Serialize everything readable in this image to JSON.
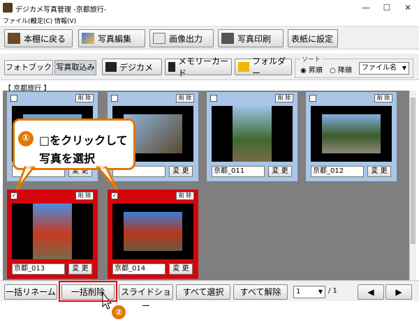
{
  "window": {
    "title": "デジカメ写真管理 -京都旅行-",
    "minimize": "—",
    "maximize": "☐",
    "close": "✕"
  },
  "menu": [
    "ファイル(F)",
    "設定(C)",
    "情報(V)"
  ],
  "toolbar": {
    "back": "本棚に戻る",
    "edit": "写真編集",
    "export": "画像出力",
    "print": "写真印刷",
    "cover": "表紙に設定"
  },
  "modes": {
    "photobook": "フォトブック",
    "import": "写真取込み"
  },
  "sources": {
    "camera": "デジカメ",
    "memory": "メモリーカード",
    "folder": "フォルダー"
  },
  "sort": {
    "legend": "ソート",
    "asc": "昇順",
    "desc": "降順",
    "field": "ファイル名"
  },
  "breadcrumb": "【 京都旅行 】",
  "photos": [
    {
      "name": "",
      "selected": false
    },
    {
      "name": "",
      "selected": false
    },
    {
      "name": "京都_011",
      "selected": false
    },
    {
      "name": "京都_012",
      "selected": false
    },
    {
      "name": "京都_013",
      "selected": true
    },
    {
      "name": "京都_014",
      "selected": true
    }
  ],
  "card_labels": {
    "delete": "削 除",
    "change": "変 更",
    "check": "✓"
  },
  "bottom": {
    "rename": "一括リネーム",
    "delete_all": "一括削除",
    "slideshow": "スライドショー",
    "select_all": "すべて選択",
    "deselect_all": "すべて解除",
    "page": "1",
    "page_total": "/ 1",
    "prev": "◀",
    "next": "▶"
  },
  "callout": {
    "number": "①",
    "line1": "□をクリックして",
    "line2": "写真を選択",
    "step2": "②"
  },
  "colors": {
    "selected_card": "#d4060c",
    "normal_card": "#a9c6e8",
    "accent": "#e07800"
  }
}
